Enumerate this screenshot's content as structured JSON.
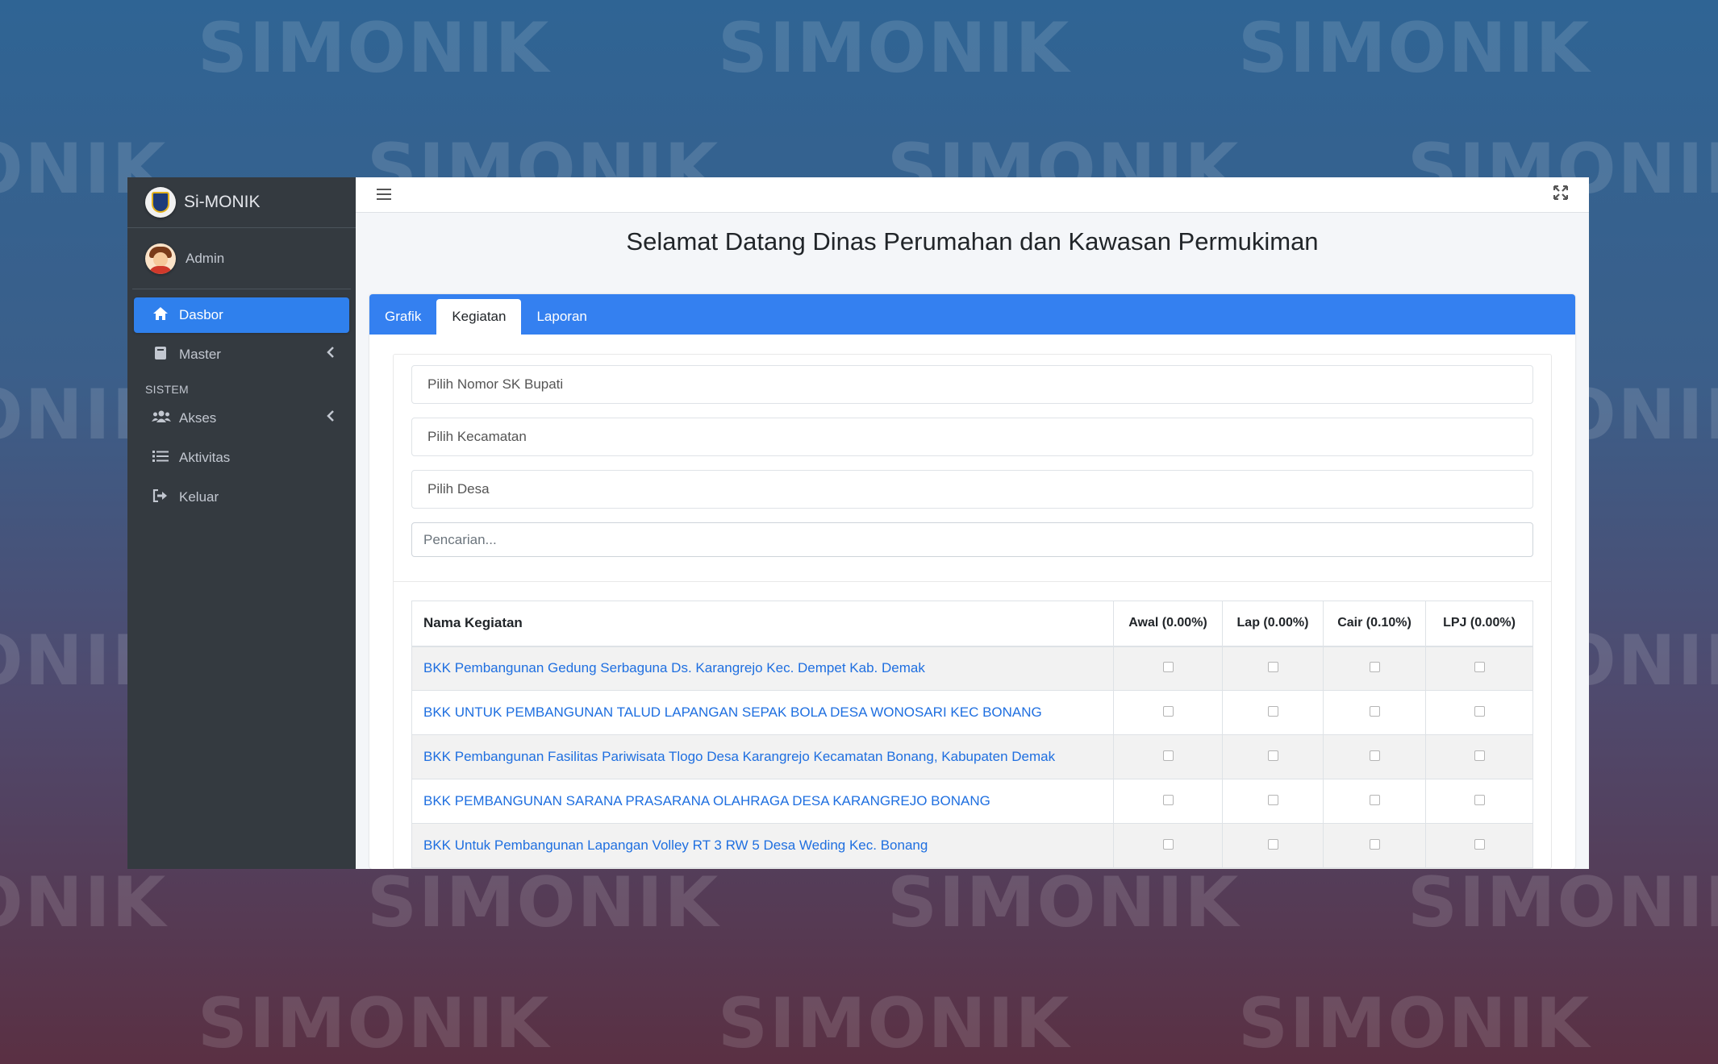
{
  "watermark": "SIMONIK",
  "colors": {
    "sidebar_bg": "#343a40",
    "accent": "#2f80ed",
    "link": "#1f6fe0"
  },
  "brand": {
    "name": "Si-MONIK",
    "logo_icon": "regency-crest-icon"
  },
  "user": {
    "name": "Admin",
    "avatar_icon": "user-avatar-icon"
  },
  "nav": {
    "dasbor": {
      "label": "Dasbor",
      "icon": "home-icon"
    },
    "master": {
      "label": "Master",
      "icon": "book-icon"
    },
    "section_sistem": "SISTEM",
    "akses": {
      "label": "Akses",
      "icon": "users-icon"
    },
    "aktivitas": {
      "label": "Aktivitas",
      "icon": "list-icon"
    },
    "keluar": {
      "label": "Keluar",
      "icon": "sign-out-icon"
    }
  },
  "topbar": {
    "menu_icon": "hamburger-icon",
    "fullscreen_icon": "expand-icon"
  },
  "page_title": "Selamat Datang Dinas Perumahan dan Kawasan Permukiman",
  "tabs": [
    {
      "label": "Grafik",
      "active": false
    },
    {
      "label": "Kegiatan",
      "active": true
    },
    {
      "label": "Laporan",
      "active": false
    }
  ],
  "filters": {
    "sk_bupati": "Pilih Nomor SK Bupati",
    "kecamatan": "Pilih Kecamatan",
    "desa": "Pilih Desa",
    "search_placeholder": "Pencarian..."
  },
  "table": {
    "headers": [
      "Nama Kegiatan",
      "Awal (0.00%)",
      "Lap (0.00%)",
      "Cair (0.10%)",
      "LPJ (0.00%)"
    ],
    "rows": [
      {
        "name": "BKK Pembangunan Gedung Serbaguna Ds. Karangrejo Kec. Dempet Kab. Demak",
        "awal": false,
        "lap": false,
        "cair": false,
        "lpj": false
      },
      {
        "name": "BKK UNTUK PEMBANGUNAN TALUD LAPANGAN SEPAK BOLA DESA WONOSARI KEC BONANG",
        "awal": false,
        "lap": false,
        "cair": false,
        "lpj": false
      },
      {
        "name": "BKK Pembangunan Fasilitas Pariwisata Tlogo Desa Karangrejo Kecamatan Bonang, Kabupaten Demak",
        "awal": false,
        "lap": false,
        "cair": false,
        "lpj": false
      },
      {
        "name": "BKK PEMBANGUNAN SARANA PRASARANA OLAHRAGA DESA KARANGREJO BONANG",
        "awal": false,
        "lap": false,
        "cair": false,
        "lpj": false
      },
      {
        "name": "BKK Untuk Pembangunan Lapangan Volley RT 3 RW 5 Desa Weding Kec. Bonang",
        "awal": false,
        "lap": false,
        "cair": false,
        "lpj": false
      }
    ]
  }
}
